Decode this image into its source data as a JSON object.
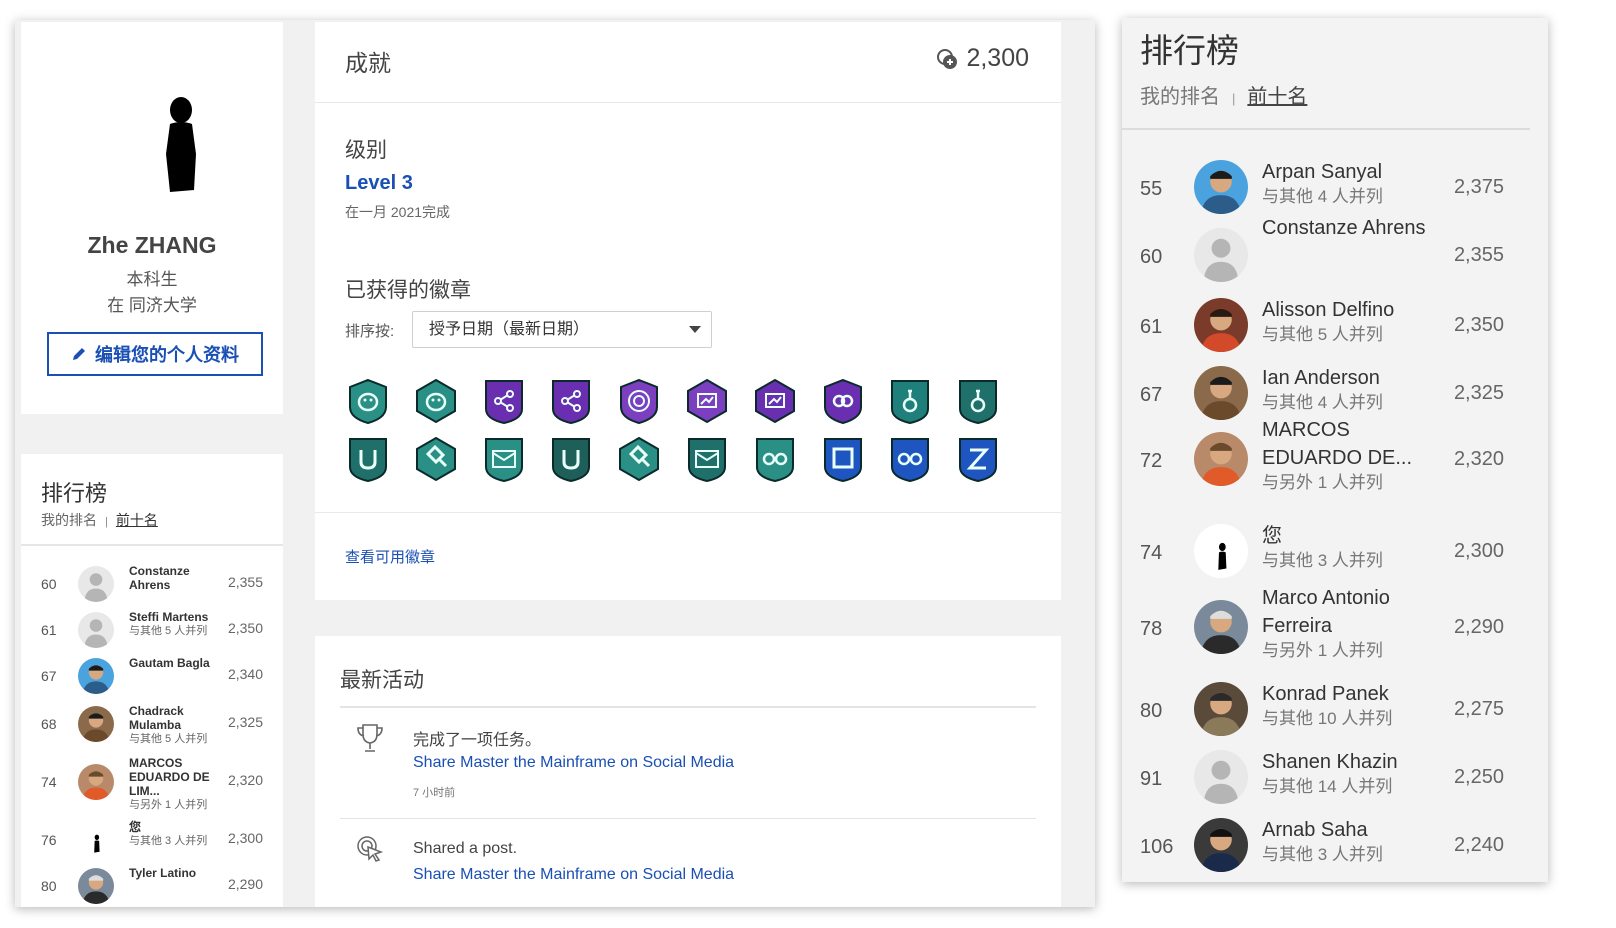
{
  "profile": {
    "name": "Zhe ZHANG",
    "role": "本科生",
    "school": "在 同济大学",
    "edit_button": "编辑您的个人资料"
  },
  "achievements": {
    "title": "成就",
    "points": "2,300",
    "level_heading": "级别",
    "level_name": "Level 3",
    "level_date": "在一月 2021完成",
    "badges_heading": "已获得的徽章",
    "sort_label": "排序按:",
    "sort_value": "授予日期（最新日期）",
    "view_badges_link": "查看可用徽章",
    "badges": [
      {
        "icon": "teal-shield-face-icon",
        "color": "#2a8f85"
      },
      {
        "icon": "teal-hexagon-face-icon",
        "color": "#2a8f85"
      },
      {
        "icon": "purple-share-shield-icon",
        "color": "#6a2fb0"
      },
      {
        "icon": "purple-share-shield-icon",
        "color": "#6a2fb0"
      },
      {
        "icon": "purple-target-icon",
        "color": "#7b3fc0"
      },
      {
        "icon": "purple-chart-icon",
        "color": "#7b3fc0"
      },
      {
        "icon": "purple-chart-icon",
        "color": "#6a2fb0"
      },
      {
        "icon": "purple-link-icon",
        "color": "#6a2fb0"
      },
      {
        "icon": "teal-flask-icon",
        "color": "#1f7f7a"
      },
      {
        "icon": "teal-flask-icon",
        "color": "#1f6f6a"
      },
      {
        "icon": "teal-u-shield-icon",
        "color": "#1f6f6a"
      },
      {
        "icon": "teal-hammer-icon",
        "color": "#2a8f85"
      },
      {
        "icon": "teal-envelope-icon",
        "color": "#2a8f85"
      },
      {
        "icon": "teal-u-shield-icon",
        "color": "#1f5f5a"
      },
      {
        "icon": "teal-hammer-icon",
        "color": "#2a8f85"
      },
      {
        "icon": "teal-envelope-icon",
        "color": "#1f6f6a"
      },
      {
        "icon": "teal-glasses-shield-icon",
        "color": "#2a8f85"
      },
      {
        "icon": "blue-square-shield-icon",
        "color": "#1f55c0"
      },
      {
        "icon": "blue-glasses-shield-icon",
        "color": "#1f55c0"
      },
      {
        "icon": "blue-z-shield-icon",
        "color": "#1f55c0"
      }
    ]
  },
  "activity": {
    "heading": "最新活动",
    "items": [
      {
        "text": "完成了一项任务。",
        "link": "Share Master the Mainframe on Social Media",
        "time": "7 小时前"
      },
      {
        "text": "Shared a post.",
        "link": "Share Master the Mainframe on Social Media"
      }
    ]
  },
  "leaderboard_small": {
    "title": "排行榜",
    "tab_my_rank": "我的排名",
    "tab_top_ten": "前十名",
    "rows": [
      {
        "rank": "60",
        "name": "Constanze Ahrens",
        "sub": "",
        "points": "2,355"
      },
      {
        "rank": "61",
        "name": "Steffi Martens",
        "sub": "与其他 5 人并列",
        "points": "2,350"
      },
      {
        "rank": "67",
        "name": "Gautam Bagla",
        "sub": "",
        "points": "2,340"
      },
      {
        "rank": "68",
        "name": "Chadrack Mulamba",
        "sub": "与其他 5 人并列",
        "points": "2,325"
      },
      {
        "rank": "74",
        "name": "MARCOS EDUARDO DE LIM...",
        "sub": "与另外 1 人并列",
        "points": "2,320"
      },
      {
        "rank": "76",
        "name": "您",
        "sub": "与其他 3 人并列",
        "points": "2,300"
      },
      {
        "rank": "80",
        "name": "Tyler Latino",
        "sub": "",
        "points": "2,290"
      }
    ]
  },
  "leaderboard_big": {
    "title": "排行榜",
    "tab_my_rank": "我的排名",
    "tab_top_ten": "前十名",
    "rows": [
      {
        "rank": "55",
        "name": "Arpan Sanyal",
        "sub": "与其他 4 人并列",
        "points": "2,375"
      },
      {
        "rank": "60",
        "name": "Constanze Ahrens",
        "sub": "",
        "points": "2,355"
      },
      {
        "rank": "61",
        "name": "Alisson Delfino",
        "sub": "与其他 5 人并列",
        "points": "2,350"
      },
      {
        "rank": "67",
        "name": "Ian Anderson",
        "sub": "与其他 4 人并列",
        "points": "2,325"
      },
      {
        "rank": "72",
        "name": "MARCOS EDUARDO DE...",
        "sub": "与另外 1 人并列",
        "points": "2,320"
      },
      {
        "rank": "74",
        "name": "您",
        "sub": "与其他 3 人并列",
        "points": "2,300"
      },
      {
        "rank": "78",
        "name": "Marco Antonio Ferreira",
        "sub": "与另外 1 人并列",
        "points": "2,290"
      },
      {
        "rank": "80",
        "name": "Konrad Panek",
        "sub": "与其他 10 人并列",
        "points": "2,275"
      },
      {
        "rank": "91",
        "name": "Shanen Khazin",
        "sub": "与其他 14 人并列",
        "points": "2,250"
      },
      {
        "rank": "106",
        "name": "Arnab Saha",
        "sub": "与其他 3 人并列",
        "points": "2,240"
      }
    ]
  }
}
